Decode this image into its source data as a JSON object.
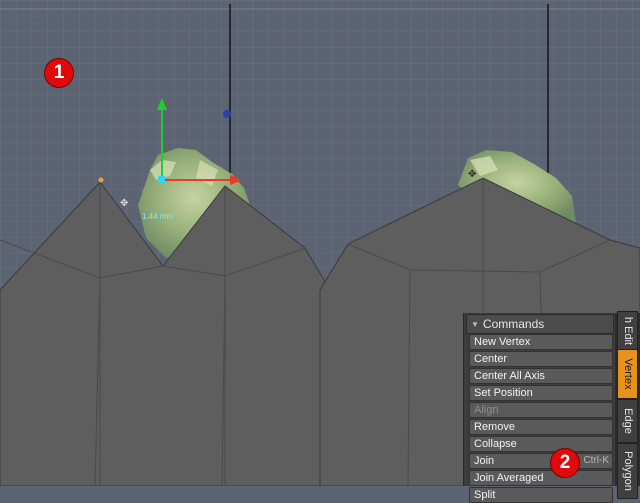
{
  "viewport": {
    "measure_label": "1.44 mm"
  },
  "markers": [
    "1",
    "2"
  ],
  "panel": {
    "title": "Commands",
    "commands": [
      {
        "label": "New Vertex",
        "shortcut": "",
        "enabled": true
      },
      {
        "label": "Center",
        "shortcut": "",
        "enabled": true
      },
      {
        "label": "Center All Axis",
        "shortcut": "",
        "enabled": true
      },
      {
        "label": "Set Position",
        "shortcut": "",
        "enabled": true
      },
      {
        "label": "Align",
        "shortcut": "",
        "enabled": false
      },
      {
        "label": "Remove",
        "shortcut": "",
        "enabled": true
      },
      {
        "label": "Collapse",
        "shortcut": "",
        "enabled": true
      },
      {
        "label": "Join",
        "shortcut": "Ctrl-K",
        "enabled": true
      },
      {
        "label": "Join Averaged",
        "shortcut": "",
        "enabled": true
      },
      {
        "label": "Split",
        "shortcut": "",
        "enabled": true
      }
    ]
  },
  "tabs": [
    {
      "label": "h Edit",
      "active": false
    },
    {
      "label": "Vertex",
      "active": true
    },
    {
      "label": "Edge",
      "active": false
    },
    {
      "label": "Polygon",
      "active": false
    }
  ],
  "colors": {
    "background": "#5c6373",
    "mesh": "#5e5e5e",
    "active_tab": "#e8921e",
    "marker": "#e10a0a"
  }
}
